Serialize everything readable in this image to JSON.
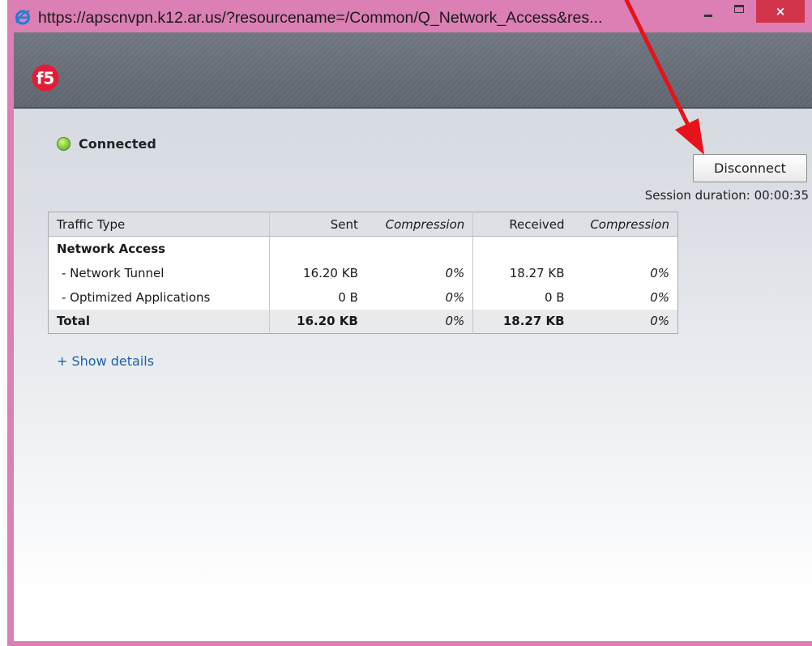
{
  "window": {
    "title": "https://apscnvpn.k12.ar.us/?resourcename=/Common/Q_Network_Access&res...",
    "close_glyph": "×",
    "icons": {
      "browser": "ie-icon",
      "minimize": "minimize-icon",
      "maximize": "maximize-icon",
      "close": "close-icon"
    }
  },
  "header": {
    "logo": "f5-logo",
    "logo_text": "f5"
  },
  "status": {
    "label": "Connected",
    "indicator_color": "#8fd142"
  },
  "actions": {
    "disconnect_label": "Disconnect"
  },
  "session": {
    "duration_text": "Session duration: 00:00:35"
  },
  "table": {
    "headers": [
      "Traffic Type",
      "Sent",
      "Compression",
      "Received",
      "Compression"
    ],
    "rows": [
      {
        "type": "Network Access",
        "sent": "",
        "sent_compression": "",
        "received": "",
        "received_compression": ""
      },
      {
        "type": "- Network Tunnel",
        "sent": "16.20 KB",
        "sent_compression": "0%",
        "received": "18.27 KB",
        "received_compression": "0%"
      },
      {
        "type": "- Optimized Applications",
        "sent": "0 B",
        "sent_compression": "0%",
        "received": "0 B",
        "received_compression": "0%"
      }
    ],
    "total": {
      "type": "Total",
      "sent": "16.20 KB",
      "sent_compression": "0%",
      "received": "18.27 KB",
      "received_compression": "0%"
    }
  },
  "links": {
    "show_details": "+ Show details"
  },
  "colors": {
    "window_frame": "#dc7fb4",
    "close_button": "#d1344b",
    "link": "#1e5fa8",
    "annotation_arrow": "#e8121b"
  }
}
